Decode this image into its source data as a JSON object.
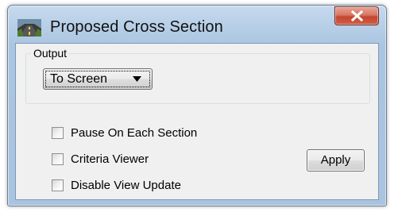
{
  "window": {
    "title": "Proposed Cross Section",
    "icon": "road-section-icon",
    "close_icon": "close-icon"
  },
  "output": {
    "group_label": "Output",
    "selected": "To Screen"
  },
  "options": [
    {
      "label": "Pause On Each Section",
      "checked": false
    },
    {
      "label": "Criteria Viewer",
      "checked": false
    },
    {
      "label": "Disable View Update",
      "checked": false
    }
  ],
  "apply_label": "Apply",
  "colors": {
    "titlebar": "#b9d1ea",
    "close_button": "#c4452e",
    "client_background": "#f0f0f0"
  }
}
